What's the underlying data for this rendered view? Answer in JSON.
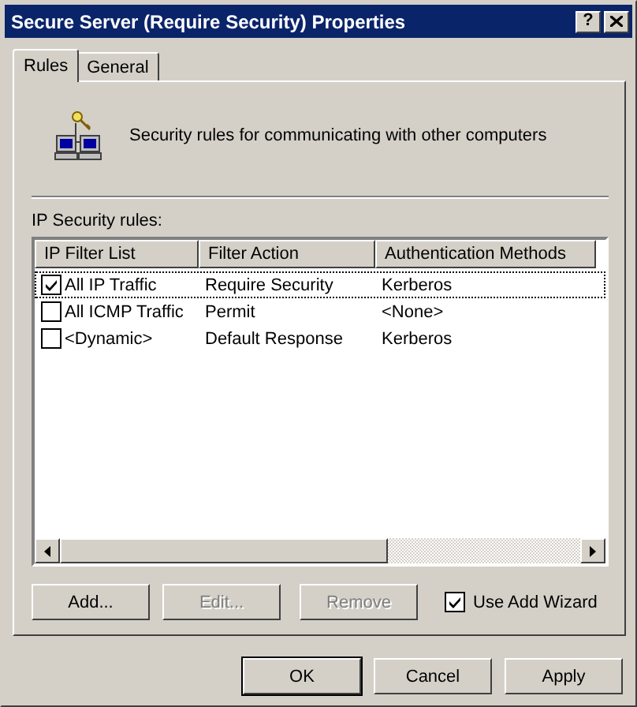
{
  "window": {
    "title": "Secure Server (Require Security) Properties",
    "help_label": "?"
  },
  "tabs": [
    {
      "label": "Rules",
      "selected": true
    },
    {
      "label": "General",
      "selected": false
    }
  ],
  "description": "Security rules for communicating with other computers",
  "list_label": "IP Security rules:",
  "table": {
    "columns": [
      "IP Filter List",
      "Filter Action",
      "Authentication Methods"
    ],
    "rows": [
      {
        "checked": true,
        "focused": true,
        "cells": [
          "All IP Traffic",
          "Require Security",
          "Kerberos"
        ]
      },
      {
        "checked": false,
        "focused": false,
        "cells": [
          "All ICMP Traffic",
          "Permit",
          "<None>"
        ]
      },
      {
        "checked": false,
        "focused": false,
        "cells": [
          "<Dynamic>",
          "Default Response",
          "Kerberos"
        ]
      }
    ]
  },
  "buttons": [
    {
      "label": "Add...",
      "disabled": false
    },
    {
      "label": "Edit...",
      "disabled": true
    },
    {
      "label": "Remove",
      "disabled": true
    }
  ],
  "wizard": {
    "label": "Use Add Wizard",
    "checked": true
  },
  "dialog_buttons": [
    {
      "label": "OK",
      "default": true
    },
    {
      "label": "Cancel",
      "default": false
    },
    {
      "label": "Apply",
      "default": false
    }
  ]
}
